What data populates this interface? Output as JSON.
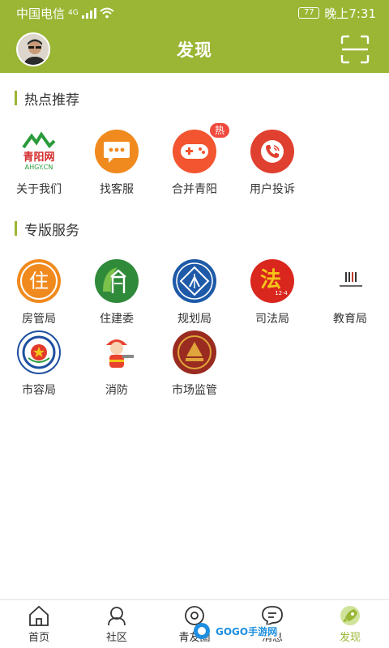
{
  "status_bar": {
    "carrier": "中国电信",
    "network": "4G",
    "battery": "77",
    "time": "晚上7:31"
  },
  "app_bar": {
    "title": "发现"
  },
  "sections": [
    {
      "title": "热点推荐"
    },
    {
      "title": "专版服务"
    }
  ],
  "hot": [
    {
      "label": "关于我们",
      "icon": "qingyang-net-logo",
      "logo_text": "青阳网",
      "logo_sub": "AHGY.CN"
    },
    {
      "label": "找客服",
      "icon": "chat-bubble-icon"
    },
    {
      "label": "合并青阳",
      "icon": "gamepad-icon",
      "badge": "热"
    },
    {
      "label": "用户投诉",
      "icon": "phone-icon"
    }
  ],
  "services": [
    {
      "label": "房管局",
      "icon": "housing-bureau-logo",
      "glyph": "住"
    },
    {
      "label": "住建委",
      "icon": "construction-committee-logo"
    },
    {
      "label": "规划局",
      "icon": "planning-bureau-logo"
    },
    {
      "label": "司法局",
      "icon": "justice-bureau-logo",
      "glyph": "法",
      "sub": "12·4"
    },
    {
      "label": "教育局",
      "icon": "education-bureau-logo"
    },
    {
      "label": "市容局",
      "icon": "city-appearance-logo"
    },
    {
      "label": "消防",
      "icon": "firefighter-icon"
    },
    {
      "label": "市场监管",
      "icon": "market-supervision-logo"
    }
  ],
  "tabs": [
    {
      "label": "首页",
      "icon": "home-icon"
    },
    {
      "label": "社区",
      "icon": "community-icon"
    },
    {
      "label": "青友圈",
      "icon": "eye-icon"
    },
    {
      "label": "消息",
      "icon": "message-icon"
    },
    {
      "label": "发现",
      "icon": "rocket-icon",
      "active": true
    }
  ],
  "watermark": {
    "text": "GOGO手游网"
  },
  "colors": {
    "brand": "#9ab634",
    "hot_badge": "#f04a3f",
    "orange": "#f08a1e",
    "red": "#e0402f",
    "blue": "#1e5aa8"
  }
}
